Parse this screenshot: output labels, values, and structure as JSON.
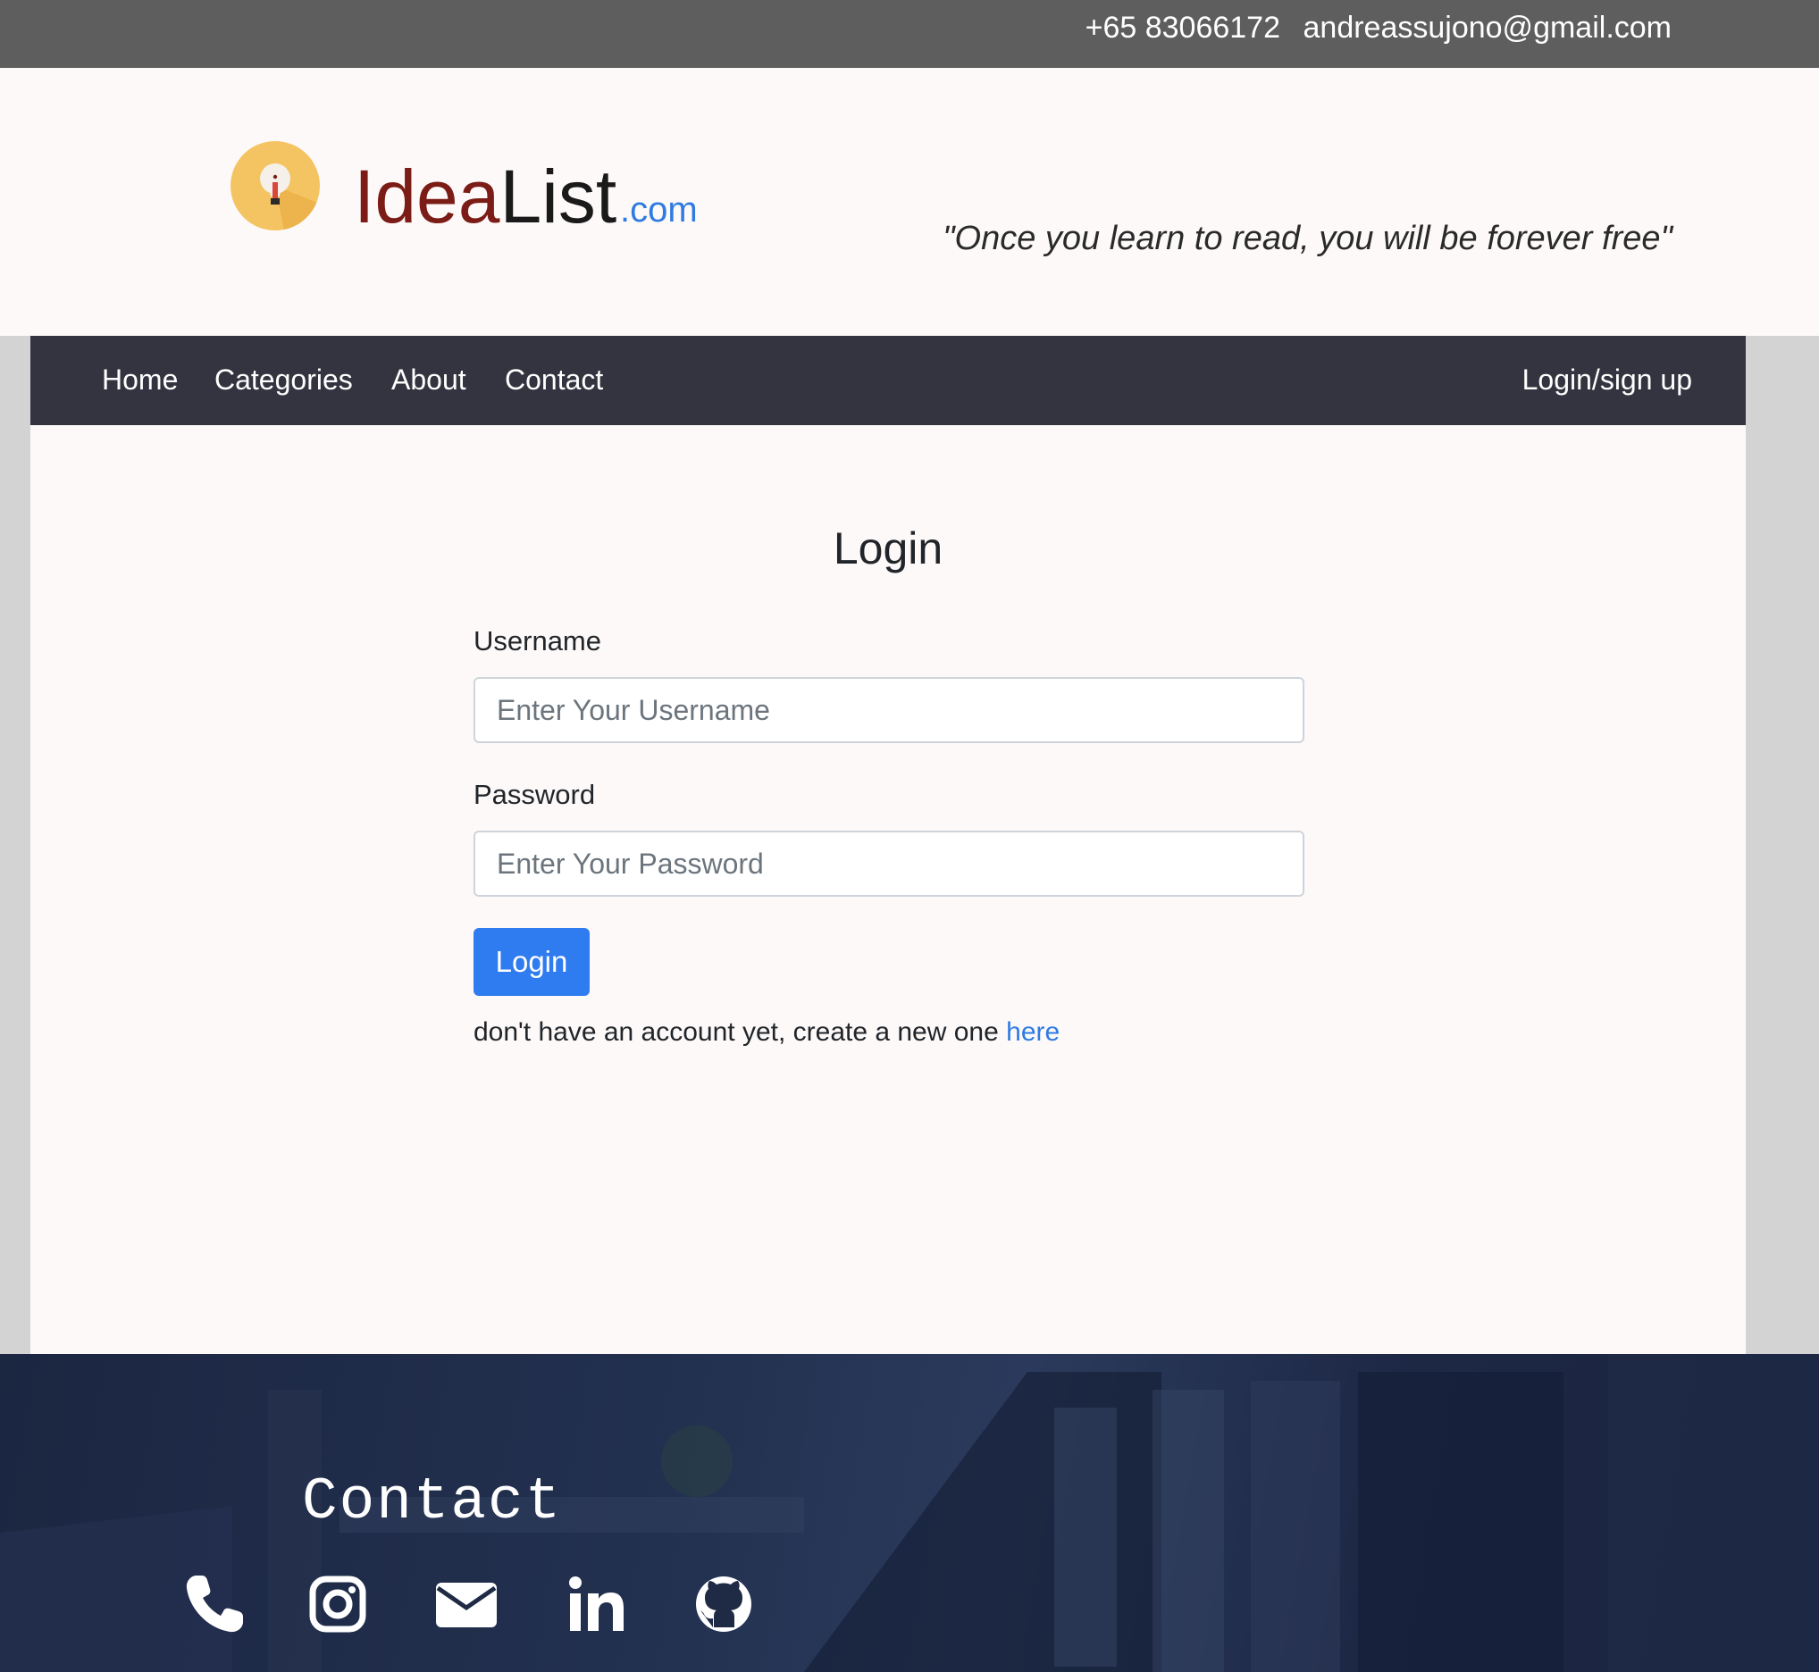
{
  "topbar": {
    "phone": "+65 83066172",
    "email": "andreassujono@gmail.com"
  },
  "brand": {
    "name_part1": "Idea",
    "name_part2": "List",
    "suffix": ".com",
    "tagline": "\"Once you learn to read, you will be forever free\"",
    "logo_icon": "lightbulb-icon"
  },
  "nav": {
    "home": "Home",
    "categories": "Categories",
    "about": "About",
    "contact": "Contact",
    "login": "Login/sign up"
  },
  "login_form": {
    "title": "Login",
    "username_label": "Username",
    "username_placeholder": "Enter Your Username",
    "username_value": "",
    "password_label": "Password",
    "password_placeholder": "Enter Your Password",
    "password_value": "",
    "submit_label": "Login",
    "signup_prompt": "don't have an account yet, create a new one ",
    "signup_link": "here"
  },
  "footer": {
    "title": "Contact",
    "social_icons": [
      "phone-icon",
      "instagram-icon",
      "mail-icon",
      "linkedin-icon",
      "github-icon"
    ]
  },
  "colors": {
    "topbar_bg": "#5e5e5e",
    "nav_bg": "#343441",
    "page_bg": "#fdf9f9",
    "primary": "#2f7bf0",
    "brand_dark_red": "#7b1d16",
    "footer_bg": "#1b2641"
  }
}
